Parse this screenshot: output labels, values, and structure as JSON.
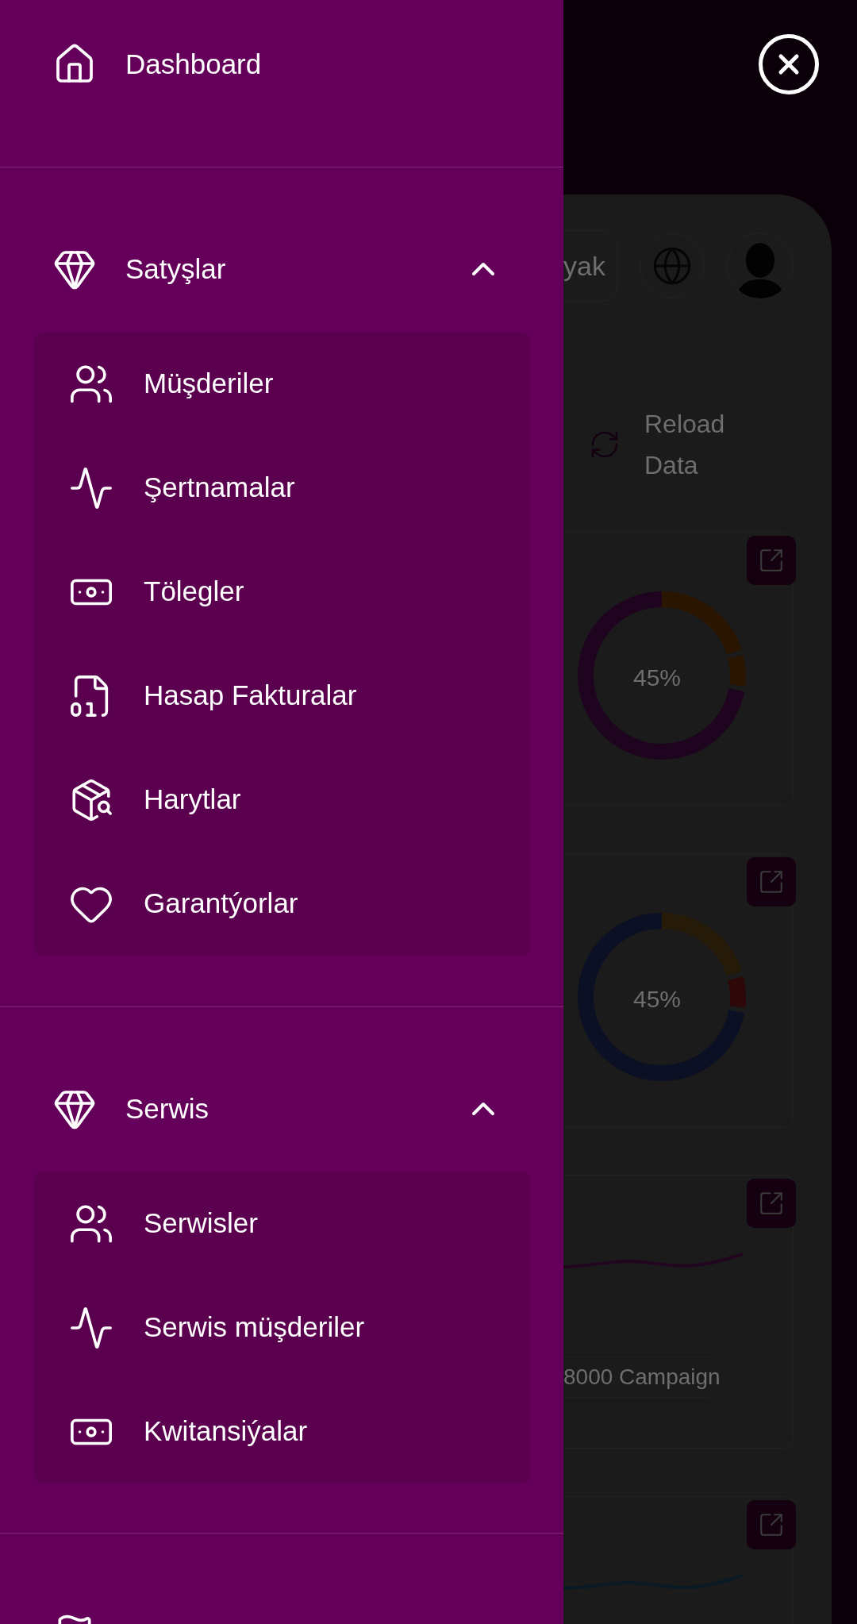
{
  "drawer": {
    "sections": [
      {
        "kind": "link",
        "label": "Dashboard"
      },
      {
        "kind": "group",
        "label": "Satyşlar",
        "expanded": true,
        "items": [
          "Müşderiler",
          "Şertnamalar",
          "Tölegler",
          "Hasap Fakturalar",
          "Harytlar",
          "Garantýorlar"
        ]
      },
      {
        "kind": "group",
        "label": "Serwis",
        "expanded": true,
        "items": [
          "Serwisler",
          "Serwis müşderiler",
          "Kwitansiýalar"
        ]
      }
    ]
  },
  "page": {
    "top_bar_field": "yak",
    "reload_button": "Reload Data",
    "cards": [
      {
        "kind": "donut",
        "center_label": "45%"
      },
      {
        "kind": "donut",
        "center_label": "45%"
      },
      {
        "kind": "wave",
        "caption": "8000 Campaign"
      },
      {
        "kind": "wave"
      }
    ]
  }
}
